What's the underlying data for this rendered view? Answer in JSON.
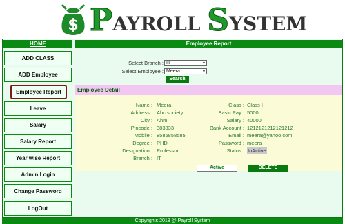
{
  "header": {
    "title_big1": "P",
    "title_small1": "AYROLL ",
    "title_big2": "S",
    "title_small2": "YSTEM",
    "logo_icon": "money-bag-icon",
    "accent": "#1f9a2a"
  },
  "sidebar": {
    "home": "HOME",
    "items": [
      {
        "label": "ADD CLASS"
      },
      {
        "label": "ADD Employee"
      },
      {
        "label": "Employee Report",
        "active": true
      },
      {
        "label": "Leave"
      },
      {
        "label": "Salary"
      },
      {
        "label": "Salary Report"
      },
      {
        "label": "Year wise Report"
      },
      {
        "label": "Admin Login"
      },
      {
        "label": "Change Password"
      },
      {
        "label": "LogOut"
      }
    ]
  },
  "main": {
    "title": "Employee Report",
    "select_branch_label": "Select Branch :",
    "select_branch_value": "IT",
    "select_employee_label": "Select Employee :",
    "select_employee_value": "Meera",
    "search_label": "Search",
    "detail_title": "Employee Detail",
    "left_fields": [
      {
        "label": "Name :",
        "value": "Meera"
      },
      {
        "label": "Address :",
        "value": "Abc society"
      },
      {
        "label": "City :",
        "value": "Ahm"
      },
      {
        "label": "Pincode :",
        "value": "383333"
      },
      {
        "label": "Mobile :",
        "value": "8585858585"
      },
      {
        "label": "Degree :",
        "value": "PHD"
      },
      {
        "label": "Designation :",
        "value": "Professor"
      },
      {
        "label": "Branch :",
        "value": "IT"
      }
    ],
    "right_fields": [
      {
        "label": "Class :",
        "value": "Class I"
      },
      {
        "label": "Basic Pay :",
        "value": "5000"
      },
      {
        "label": "Salary :",
        "value": "40000"
      },
      {
        "label": "Bank Account :",
        "value": "1212121212121212"
      },
      {
        "label": "Email :",
        "value": "meera@yahoo.com"
      },
      {
        "label": "Password :",
        "value": "meera"
      },
      {
        "label": "Status :",
        "value": "InActive"
      }
    ],
    "active_label": "Active",
    "delete_label": "DELETE"
  },
  "footer": {
    "text": "Copyrights 2018 @ Payroll System"
  }
}
